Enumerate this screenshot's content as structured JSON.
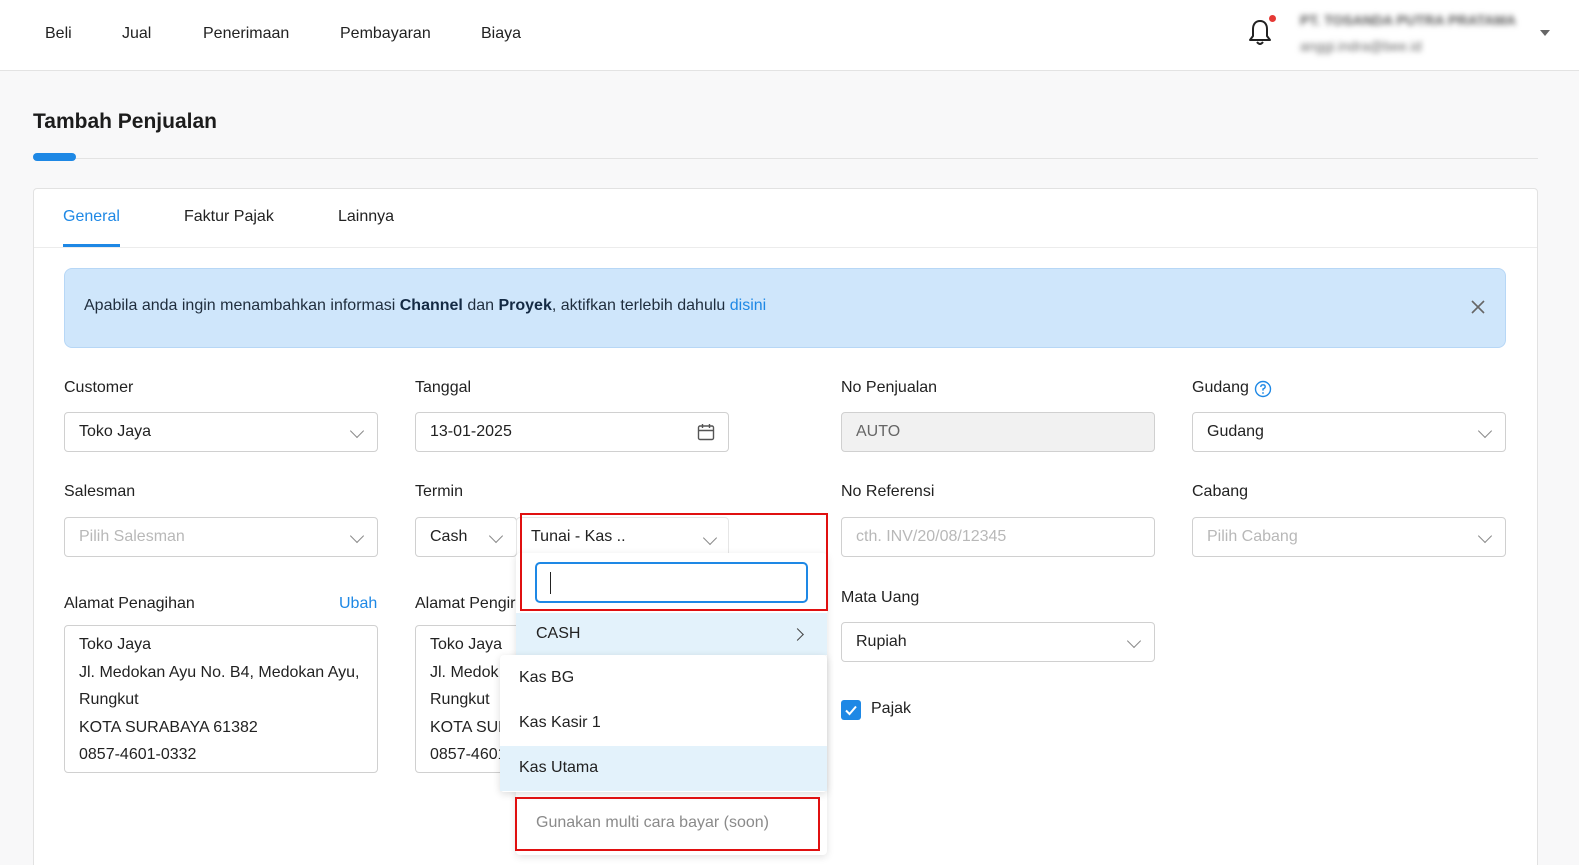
{
  "nav": {
    "items": [
      "Beli",
      "Jual",
      "Penerimaan",
      "Pembayaran",
      "Biaya"
    ]
  },
  "account": {
    "company": "PT. TOSANDA PUTRA PRATAMA",
    "email": "anggi.indra@bee.id"
  },
  "page": {
    "title": "Tambah Penjualan"
  },
  "tabs": [
    "General",
    "Faktur Pajak",
    "Lainnya"
  ],
  "alert": {
    "prefix": "Apabila anda ingin menambahkan informasi ",
    "channel": "Channel",
    "and": " dan ",
    "proyek": "Proyek",
    "suffix": ", aktifkan terlebih dahulu ",
    "link": "disini"
  },
  "form": {
    "customer": {
      "label": "Customer",
      "value": "Toko Jaya"
    },
    "tanggal": {
      "label": "Tanggal",
      "value": "13-01-2025"
    },
    "no_penjualan": {
      "label": "No Penjualan",
      "value": "AUTO"
    },
    "gudang": {
      "label": "Gudang",
      "value": "Gudang"
    },
    "salesman": {
      "label": "Salesman",
      "placeholder": "Pilih Salesman"
    },
    "termin": {
      "label": "Termin",
      "value": "Cash"
    },
    "payment_method": {
      "value": "Tunai - Kas .."
    },
    "no_referensi": {
      "label": "No Referensi",
      "placeholder": "cth. INV/20/08/12345"
    },
    "cabang": {
      "label": "Cabang",
      "placeholder": "Pilih Cabang"
    },
    "alamat_penagihan": {
      "label": "Alamat Penagihan",
      "change": "Ubah",
      "lines": [
        "Toko Jaya",
        "Jl. Medokan Ayu No. B4, Medokan Ayu,",
        "Rungkut",
        "KOTA SURABAYA 61382",
        "0857-4601-0332"
      ]
    },
    "alamat_pengiriman": {
      "label": "Alamat Pengir",
      "lines": [
        "Toko Jaya",
        "Jl. Medok",
        "Rungkut",
        "KOTA SUR",
        "0857-4601"
      ]
    },
    "mata_uang": {
      "label": "Mata Uang",
      "value": "Rupiah"
    },
    "pajak": {
      "label": "Pajak",
      "checked": true
    }
  },
  "dropdown": {
    "search_value": "",
    "group": "CASH",
    "items": [
      "Kas BG",
      "Kas Kasir 1",
      "Kas Utama"
    ],
    "multi_option": "Gunakan multi cara bayar (soon)"
  }
}
